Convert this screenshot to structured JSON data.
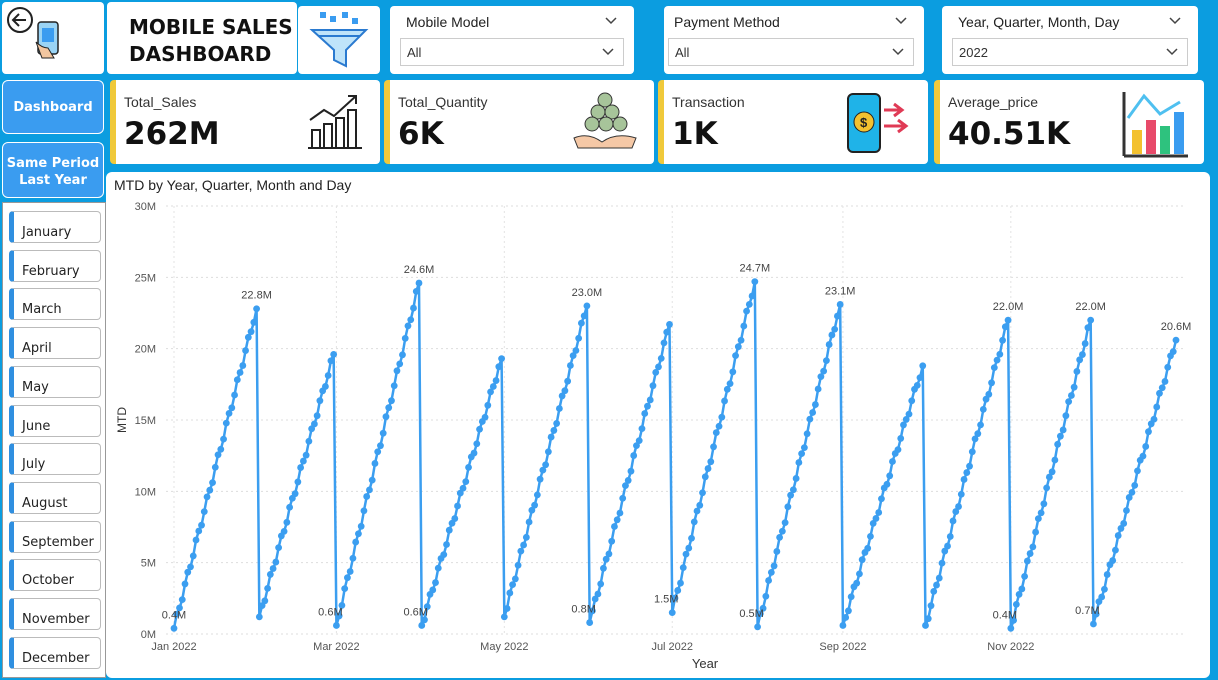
{
  "header": {
    "title_line1": "MOBILE SALES",
    "title_line2": "DASHBOARD"
  },
  "filters": [
    {
      "label": "Mobile Model",
      "value": "All"
    },
    {
      "label": "Payment Method",
      "value": "All"
    },
    {
      "label": "Year, Quarter, Month, Day",
      "value": "2022"
    }
  ],
  "nav": {
    "dashboard": "Dashboard",
    "same_period_1": "Same Period",
    "same_period_2": "Last Year"
  },
  "months": [
    "January",
    "February",
    "March",
    "April",
    "May",
    "June",
    "July",
    "August",
    "September",
    "October",
    "November",
    "December"
  ],
  "kpis": [
    {
      "label": "Total_Sales",
      "value": "262M",
      "icon": "chart-growth-icon"
    },
    {
      "label": "Total_Quantity",
      "value": "6K",
      "icon": "coins-hand-icon"
    },
    {
      "label": "Transaction",
      "value": "1K",
      "icon": "phone-payment-icon"
    },
    {
      "label": "Average_price",
      "value": "40.51K",
      "icon": "bar-chart-icon"
    }
  ],
  "colors": {
    "background": "#0b9de0",
    "accent": "#3a9cf0",
    "kpi_border": "#f0c93a",
    "line": "#3b9ef0"
  },
  "chart_data": {
    "type": "line",
    "title": "MTD by Year, Quarter, Month and Day",
    "xlabel": "Year",
    "ylabel": "MTD",
    "ylim": [
      0,
      30
    ],
    "y_unit": "M",
    "yticks": [
      "0M",
      "5M",
      "10M",
      "15M",
      "20M",
      "25M",
      "30M"
    ],
    "xticks": [
      "Jan 2022",
      "Mar 2022",
      "May 2022",
      "Jul 2022",
      "Sep 2022",
      "Nov 2022"
    ],
    "grid": true,
    "months": [
      {
        "month": "Jan 2022",
        "start": 0.4,
        "end": 22.8,
        "start_label": "0.4M",
        "end_label": "22.8M"
      },
      {
        "month": "Feb 2022",
        "start": 1.2,
        "end": 19.6,
        "start_label": "",
        "end_label": ""
      },
      {
        "month": "Mar 2022",
        "start": 0.6,
        "end": 24.6,
        "start_label": "0.6M",
        "end_label": "24.6M"
      },
      {
        "month": "Apr 2022",
        "start": 0.6,
        "end": 19.3,
        "start_label": "0.6M",
        "end_label": ""
      },
      {
        "month": "May 2022",
        "start": 1.2,
        "end": 23.0,
        "start_label": "",
        "end_label": "23.0M"
      },
      {
        "month": "Jun 2022",
        "start": 0.8,
        "end": 21.7,
        "start_label": "0.8M",
        "end_label": ""
      },
      {
        "month": "Jul 2022",
        "start": 1.5,
        "end": 24.7,
        "start_label": "1.5M",
        "end_label": "24.7M"
      },
      {
        "month": "Aug 2022",
        "start": 0.5,
        "end": 23.1,
        "start_label": "0.5M",
        "end_label": "23.1M"
      },
      {
        "month": "Sep 2022",
        "start": 0.6,
        "end": 18.8,
        "start_label": "",
        "end_label": ""
      },
      {
        "month": "Oct 2022",
        "start": 0.6,
        "end": 22.0,
        "start_label": "",
        "end_label": "22.0M"
      },
      {
        "month": "Nov 2022",
        "start": 0.4,
        "end": 22.0,
        "start_label": "0.4M",
        "end_label": "22.0M"
      },
      {
        "month": "Dec 2022",
        "start": 0.7,
        "end": 20.6,
        "start_label": "0.7M",
        "end_label": "20.6M"
      }
    ]
  }
}
